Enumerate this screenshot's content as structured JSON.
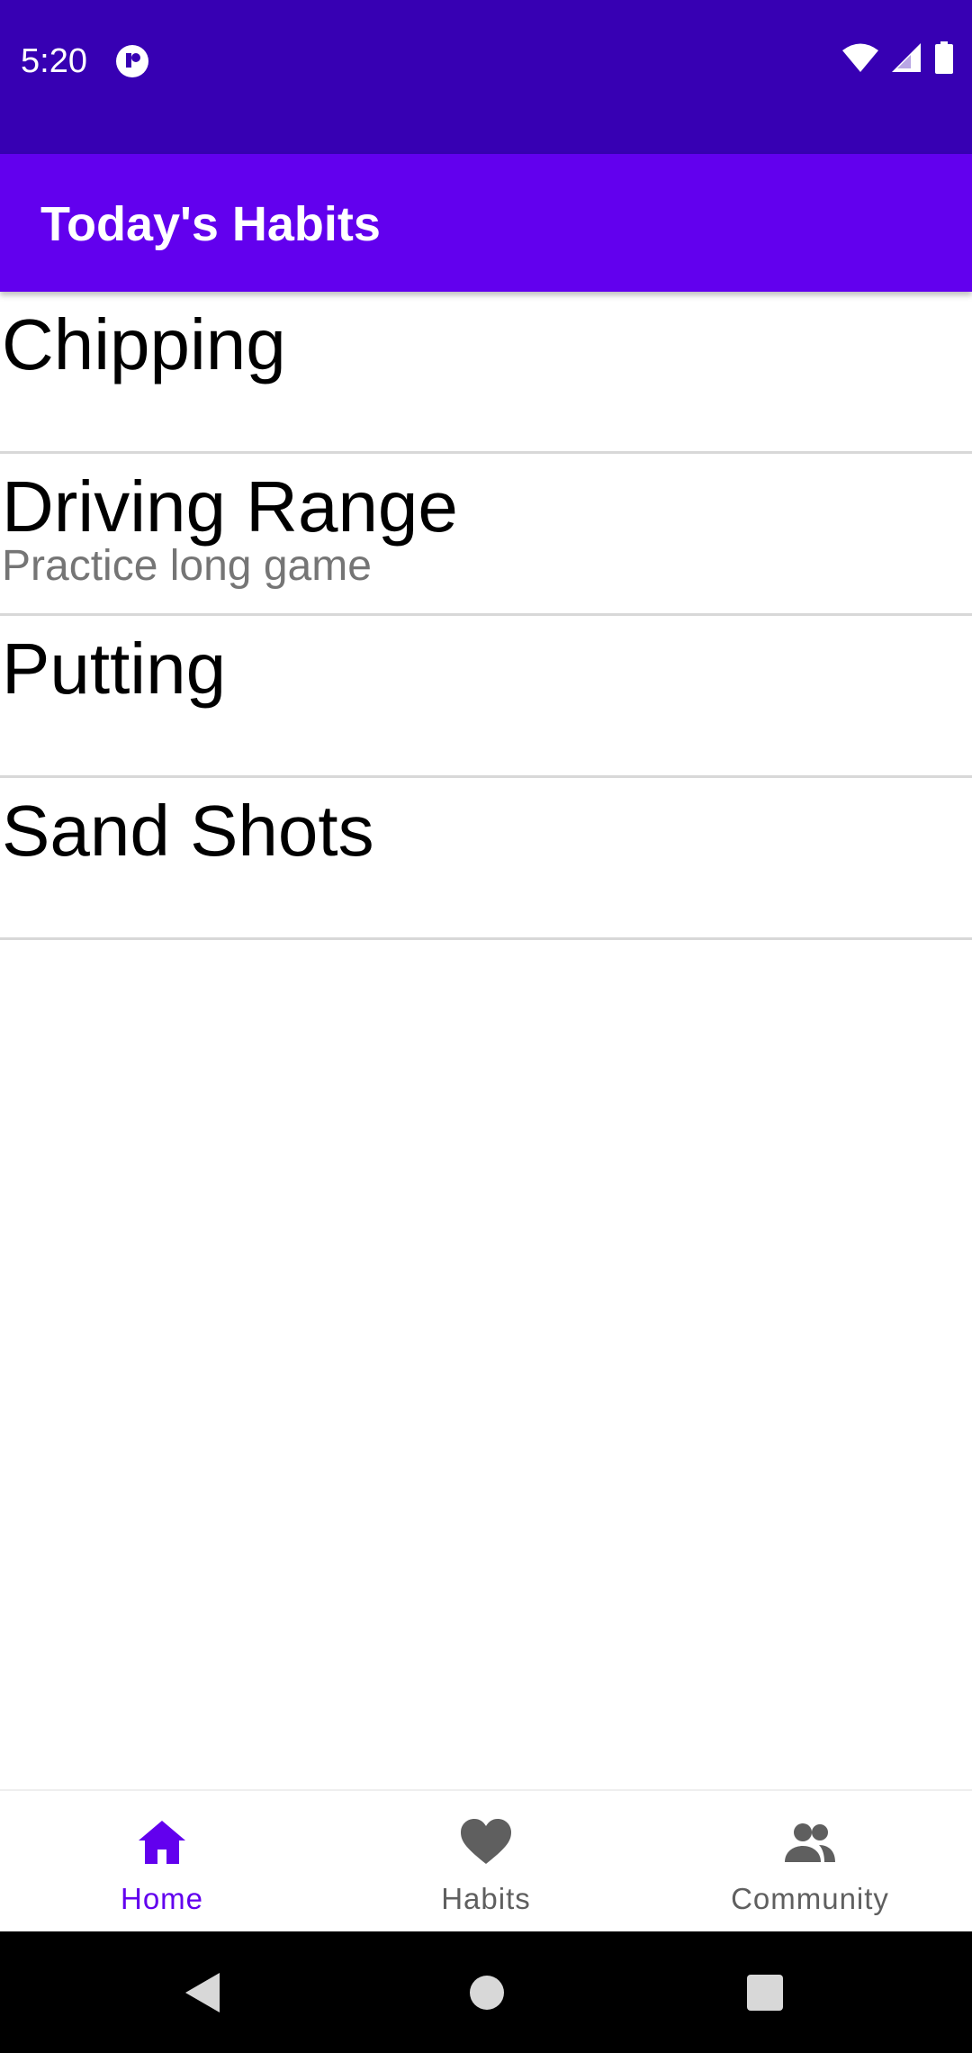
{
  "status_bar": {
    "time": "5:20",
    "app_icon": "notification-app-icon",
    "icons": [
      "wifi-icon",
      "cell-signal-icon",
      "battery-icon"
    ],
    "background_color": "#3700b3"
  },
  "app_bar": {
    "title": "Today's Habits",
    "background_color": "#6200ee"
  },
  "habits": [
    {
      "title": "Chipping",
      "description": ""
    },
    {
      "title": "Driving Range",
      "description": "Practice long game"
    },
    {
      "title": "Putting",
      "description": ""
    },
    {
      "title": "Sand Shots",
      "description": ""
    }
  ],
  "bottom_nav": {
    "active_color": "#6200ee",
    "items": [
      {
        "label": "Home",
        "icon": "home-icon",
        "active": true
      },
      {
        "label": "Habits",
        "icon": "heart-icon",
        "active": false
      },
      {
        "label": "Community",
        "icon": "people-icon",
        "active": false
      }
    ]
  },
  "system_nav": {
    "buttons": [
      "back-icon",
      "home-circle-icon",
      "recents-square-icon"
    ]
  }
}
